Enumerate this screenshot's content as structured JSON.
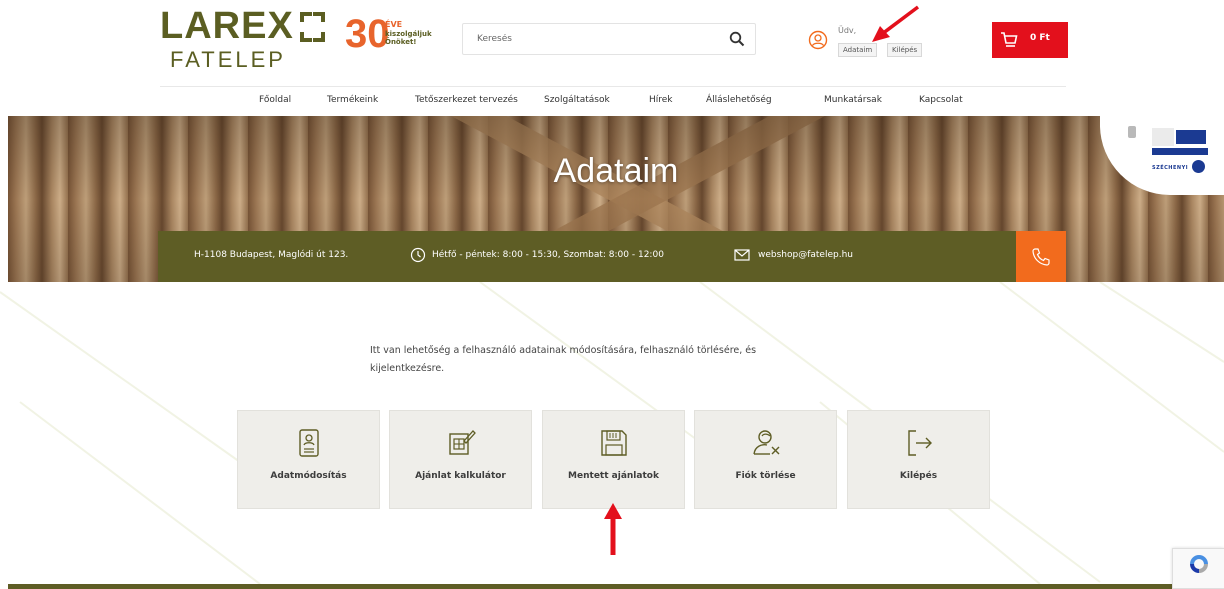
{
  "brand": {
    "name": "LAREX",
    "subname": "FATELEP",
    "anniversary_number": "30",
    "anniversary_eve": "ÉVE",
    "anniversary_line1": "kiszolgáljuk",
    "anniversary_line2": "Önöket!",
    "colors": {
      "olive": "#5e5d25",
      "orange": "#f26b1d",
      "red": "#e3101c"
    }
  },
  "search": {
    "placeholder": "Keresés",
    "icon": "search-icon"
  },
  "user": {
    "greeting": "Üdv,",
    "account_label": "Adataim",
    "logout_label": "Kilépés"
  },
  "cart": {
    "total": "0 Ft"
  },
  "nav": {
    "items": [
      {
        "label": "Főoldal"
      },
      {
        "label": "Termékeink"
      },
      {
        "label": "Tetőszerkezet tervezés"
      },
      {
        "label": "Szolgáltatások"
      },
      {
        "label": "Hírek"
      },
      {
        "label": "Álláslehetőség"
      },
      {
        "label": "Munkatársak"
      },
      {
        "label": "Kapcsolat"
      }
    ]
  },
  "hero": {
    "title": "Adataim"
  },
  "info": {
    "address": "H-1108 Budapest, Maglódi út 123.",
    "hours": "Hétfő - péntek: 8:00 - 15:30, Szombat: 8:00 - 12:00",
    "email": "webshop@fatelep.hu"
  },
  "eu": {
    "szechenyi": "SZÉCHENYI"
  },
  "intro": {
    "text": "Itt van lehetőség a felhasználó adatainak módosítására, felhasználó törlésére, és kijelentkezésre."
  },
  "cards": [
    {
      "label": "Adatmódosítás",
      "icon": "profile-document-icon"
    },
    {
      "label": "Ajánlat kalkulátor",
      "icon": "calculator-edit-icon"
    },
    {
      "label": "Mentett ajánlatok",
      "icon": "floppy-disk-icon"
    },
    {
      "label": "Fiók törlése",
      "icon": "user-remove-icon"
    },
    {
      "label": "Kilépés",
      "icon": "logout-icon"
    }
  ]
}
